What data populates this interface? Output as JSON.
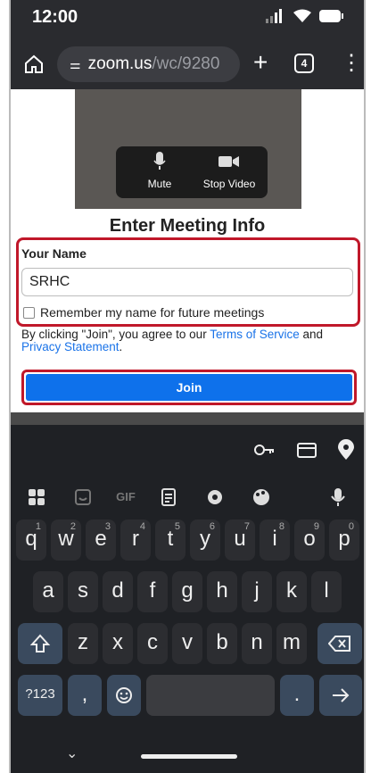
{
  "status": {
    "time": "12:00"
  },
  "browser": {
    "url_host": "zoom.us",
    "url_path": "/wc/9280",
    "tab_count": "4"
  },
  "video": {
    "mute_label": "Mute",
    "stop_video_label": "Stop Video"
  },
  "form": {
    "title": "Enter Meeting Info",
    "name_label": "Your Name",
    "name_value": "SRHC",
    "remember_label": "Remember my name for future meetings",
    "legal_prefix": "By clicking \"Join\", you agree to our ",
    "terms_link": "Terms of Service",
    "legal_and": " and ",
    "privacy_link": "Privacy Statement",
    "legal_suffix": ".",
    "join_label": "Join"
  },
  "keyboard": {
    "toolbar": [
      "apps-icon",
      "sticker-icon",
      "GIF",
      "clipboard-icon",
      "settings-icon",
      "palette-icon",
      "mic-icon"
    ],
    "suggestions": [
      "key-icon",
      "card-icon",
      "location-icon"
    ],
    "row1": [
      {
        "k": "q",
        "n": "1"
      },
      {
        "k": "w",
        "n": "2"
      },
      {
        "k": "e",
        "n": "3"
      },
      {
        "k": "r",
        "n": "4"
      },
      {
        "k": "t",
        "n": "5"
      },
      {
        "k": "y",
        "n": "6"
      },
      {
        "k": "u",
        "n": "7"
      },
      {
        "k": "i",
        "n": "8"
      },
      {
        "k": "o",
        "n": "9"
      },
      {
        "k": "p",
        "n": "0"
      }
    ],
    "row2": [
      "a",
      "s",
      "d",
      "f",
      "g",
      "h",
      "j",
      "k",
      "l"
    ],
    "row3": [
      "z",
      "x",
      "c",
      "v",
      "b",
      "n",
      "m"
    ],
    "symbols_label": "?123",
    "comma": ",",
    "period": "."
  }
}
